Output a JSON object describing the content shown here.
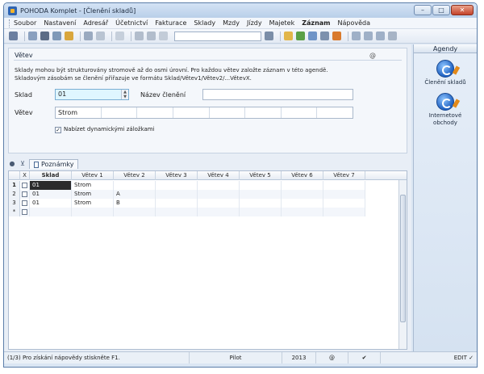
{
  "window": {
    "title": "POHODA Komplet - [Členění skladů]"
  },
  "menu": [
    "Soubor",
    "Nastavení",
    "Adresář",
    "Účetnictví",
    "Fakturace",
    "Sklady",
    "Mzdy",
    "Jízdy",
    "Majetek",
    "Záznam",
    "Nápověda"
  ],
  "toolbar": {
    "combo_value": ""
  },
  "form": {
    "section_title": "Větev",
    "at_icon": "@",
    "desc_line1": "Sklady mohou být strukturovány stromově až do osmi úrovní. Pro každou větev založte záznam v této agendě.",
    "desc_line2": "Skladovým zásobám se členění přiřazuje ve formátu Sklad/Větev1/Větev2/...VětevX.",
    "sklad_label": "Sklad",
    "sklad_value": "01",
    "nazev_label": "Název členění",
    "nazev_value": "",
    "vetev_label": "Větev",
    "vetev_cells": [
      "Strom",
      "",
      "",
      "",
      "",
      "",
      "",
      ""
    ],
    "checkbox_label": "Nabízet dynamickými záložkami",
    "checkbox_checked": "✓"
  },
  "tabs": {
    "poznamky": "Poznámky"
  },
  "grid": {
    "headers": [
      "",
      "X",
      "Sklad",
      "Větev 1",
      "Větev 2",
      "Větev 3",
      "Větev 4",
      "Větev 5",
      "Větev 6",
      "Větev 7"
    ],
    "rows": [
      {
        "num": "1",
        "sklad": "01",
        "v1": "Strom",
        "v2": ""
      },
      {
        "num": "2",
        "sklad": "01",
        "v1": "Strom",
        "v2": "A"
      },
      {
        "num": "3",
        "sklad": "01",
        "v1": "Strom",
        "v2": "B"
      },
      {
        "num": "*",
        "sklad": "",
        "v1": "",
        "v2": ""
      }
    ]
  },
  "status": {
    "help": "(1/3) Pro získání nápovědy stiskněte F1.",
    "mode": "Pilot",
    "year": "2013",
    "at": "@",
    "edit": "EDIT"
  },
  "agendy": {
    "title": "Agendy",
    "items": [
      {
        "label": "Členění skladů"
      },
      {
        "label": "Internetové obchody"
      }
    ]
  }
}
